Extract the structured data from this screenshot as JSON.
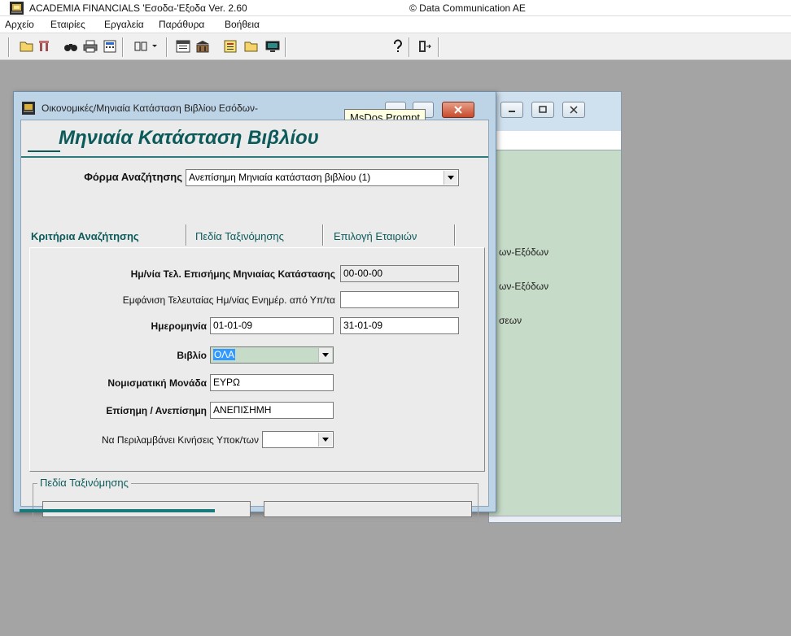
{
  "app": {
    "title": "ACADEMIA FINANCIALS 'Εσοδα-'Εξοδα Ver. 2.60",
    "copyright": "© Data Communication AE"
  },
  "menu": [
    "Αρχείο",
    "Εταιρίες",
    "Εργαλεία",
    "Παράθυρα",
    "Βοήθεια"
  ],
  "toolbar": {
    "icons": [
      "open-folder-icon",
      "tools-icon",
      "binoculars-icon",
      "printer-icon",
      "calculator-icon",
      "columns-icon",
      "calendar-icon",
      "building-icon",
      "document-icon",
      "folder-icon",
      "monitor-icon",
      "help-icon",
      "exit-door-icon"
    ]
  },
  "background_window": {
    "lines": [
      "ων-Εξόδων",
      "ων-Εξόδων",
      "σεων"
    ]
  },
  "dialog": {
    "title": "Οικονομικές/Μηνιαία Κατάσταση Βιβλίου Εσόδων-",
    "tooltip": "MsDos Prompt",
    "header": "Μηνιαία Κατάσταση Βιβλίου",
    "search_form_label": "Φόρμα Αναζήτησης",
    "search_form_value": "Ανεπίσημη Μηνιαία κατάσταση βιβλίου (1)",
    "tabs": {
      "criteria": "Κριτήρια Αναζήτησης",
      "sort_fields": "Πεδία Ταξινόμησης",
      "companies": "Επιλογή Εταιριών"
    },
    "fields": {
      "official_date_label": "Ημ/νία Τελ. Επισήμης Μηνιαίας Κατάστασης",
      "official_date_value": "00-00-00",
      "last_update_label": "Εμφάνιση Τελευταίας Ημ/νίας Ενημέρ. από Υπ/τα",
      "last_update_value": "",
      "date_label": "Ημερομηνία",
      "date_from": "01-01-09",
      "date_to": "31-01-09",
      "book_label": "Βιβλίο",
      "book_value": "ΟΛΑ",
      "currency_label": "Νομισματική Μονάδα",
      "currency_value": "ΕΥΡΩ",
      "official_label": "Επίσημη / Ανεπίσημη",
      "official_value": "ΑΝΕΠΙΣΗΜΗ",
      "include_label": "Να Περιλαμβάνει Κινήσεις Υποκ/των",
      "include_value": ""
    },
    "sort_group_title": "Πεδία Ταξινόμησης"
  },
  "colors": {
    "accent_teal": "#0c5a5a",
    "dialog_frame": "#bdd3e6",
    "background_window": "#c6dcc8",
    "selection": "#3399ff"
  }
}
